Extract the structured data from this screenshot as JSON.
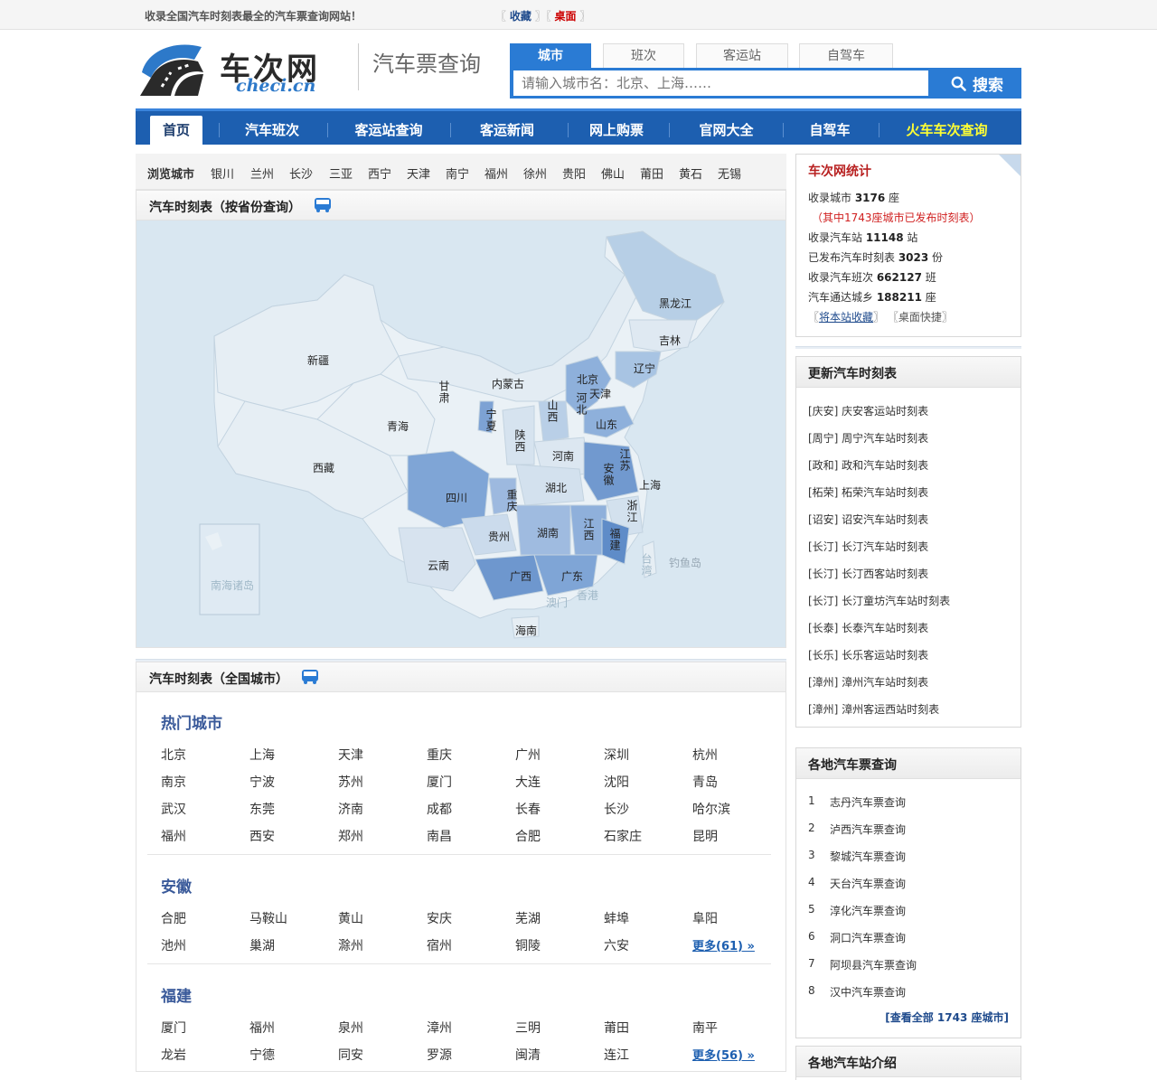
{
  "topbar": {
    "slogan": "收录全国汽车时刻表最全的汽车票查询网站！",
    "left_bracket": "〖",
    "mid_bracket": "〗〖",
    "right_bracket": "〗",
    "fav_label": "收藏",
    "desk_label": "桌面"
  },
  "header": {
    "logo_cn": "车次网",
    "logo_en": "checi.cn",
    "subtitle": "汽车票查询"
  },
  "search": {
    "tabs": [
      "城市",
      "班次",
      "客运站",
      "自驾车"
    ],
    "placeholder": "请输入城市名：北京、上海……",
    "button": "搜索"
  },
  "nav": [
    "首页",
    "汽车班次",
    "客运站查询",
    "客运新闻",
    "网上购票",
    "官网大全",
    "自驾车",
    "火车车次查询"
  ],
  "browse": {
    "label": "浏览城市",
    "cities": [
      "银川",
      "兰州",
      "长沙",
      "三亚",
      "西宁",
      "天津",
      "南宁",
      "福州",
      "徐州",
      "贵阳",
      "佛山",
      "莆田",
      "黄石",
      "无锡"
    ]
  },
  "map_panel": {
    "title": "汽车时刻表（按省份查询）",
    "provinces": [
      "黑龙江",
      "吉林",
      "辽宁",
      "内蒙古",
      "北京",
      "天津",
      "河北",
      "山西",
      "山东",
      "新疆",
      "甘肃",
      "宁夏",
      "陕西",
      "青海",
      "西藏",
      "河南",
      "江苏",
      "安徽",
      "上海",
      "四川",
      "重庆",
      "湖北",
      "浙江",
      "贵州",
      "湖南",
      "江西",
      "福建",
      "云南",
      "广西",
      "广东",
      "台湾",
      "钓鱼岛",
      "香港",
      "澳门",
      "海南",
      "南海诸岛"
    ]
  },
  "all_panel": {
    "title": "汽车时刻表（全国城市）",
    "groups": [
      {
        "name": "热门城市",
        "cities": [
          "北京",
          "上海",
          "天津",
          "重庆",
          "广州",
          "深圳",
          "杭州",
          "南京",
          "宁波",
          "苏州",
          "厦门",
          "大连",
          "沈阳",
          "青岛",
          "武汉",
          "东莞",
          "济南",
          "成都",
          "长春",
          "长沙",
          "哈尔滨",
          "福州",
          "西安",
          "郑州",
          "南昌",
          "合肥",
          "石家庄",
          "昆明"
        ],
        "more": ""
      },
      {
        "name": "安徽",
        "cities": [
          "合肥",
          "马鞍山",
          "黄山",
          "安庆",
          "芜湖",
          "蚌埠",
          "阜阳",
          "池州",
          "巢湖",
          "滁州",
          "宿州",
          "铜陵",
          "六安"
        ],
        "more": "更多(61) »"
      },
      {
        "name": "福建",
        "cities": [
          "厦门",
          "福州",
          "泉州",
          "漳州",
          "三明",
          "莆田",
          "南平",
          "龙岩",
          "宁德",
          "同安",
          "罗源",
          "闽清",
          "连江"
        ],
        "more": "更多(56) »"
      }
    ]
  },
  "stats": {
    "title": "车次网统计",
    "lines": [
      {
        "pre": "收录城市 ",
        "num": "3176",
        "post": " 座"
      },
      {
        "pre": "（其中1743座城市已发布时刻表）",
        "num": "",
        "post": ""
      },
      {
        "pre": "收录汽车站 ",
        "num": "11148",
        "post": " 站"
      },
      {
        "pre": "已发布汽车时刻表 ",
        "num": "3023",
        "post": " 份"
      },
      {
        "pre": "收录汽车班次 ",
        "num": "662127",
        "post": " 班"
      },
      {
        "pre": "汽车通达城乡 ",
        "num": "188211",
        "post": " 座"
      }
    ],
    "link1": "将本站收藏",
    "link2": "桌面快捷",
    "lb": "〖",
    "rb": "〗"
  },
  "updates": {
    "title": "更新汽车时刻表",
    "items": [
      "[庆安]  庆安客运站时刻表",
      "[周宁]  周宁汽车站时刻表",
      "[政和]  政和汽车站时刻表",
      "[柘荣]  柘荣汽车站时刻表",
      "[诏安]  诏安汽车站时刻表",
      "[长汀]  长汀汽车站时刻表",
      "[长汀]  长汀西客站时刻表",
      "[长汀]  长汀童坊汽车站时刻表",
      "[长泰]  长泰汽车站时刻表",
      "[长乐]  长乐客运站时刻表",
      "[漳州]  漳州汽车站时刻表",
      "[漳州]  漳州客运西站时刻表"
    ]
  },
  "tickets": {
    "title": "各地汽车票查询",
    "items": [
      "志丹汽车票查询",
      "泸西汽车票查询",
      "黎城汽车票查询",
      "天台汽车票查询",
      "淳化汽车票查询",
      "洞口汽车票查询",
      "阿坝县汽车票查询",
      "汉中汽车票查询"
    ],
    "numbers": [
      "1",
      "2",
      "3",
      "4",
      "5",
      "6",
      "7",
      "8"
    ],
    "view_all": "[查看全部 1743 座城市]"
  },
  "stations": {
    "title": "各地汽车站介绍"
  },
  "colors": {
    "nav_bg": "#1d5fb0",
    "accent": "#2a7bd4",
    "train_link": "#ffff33",
    "stats_title": "#b82020"
  }
}
